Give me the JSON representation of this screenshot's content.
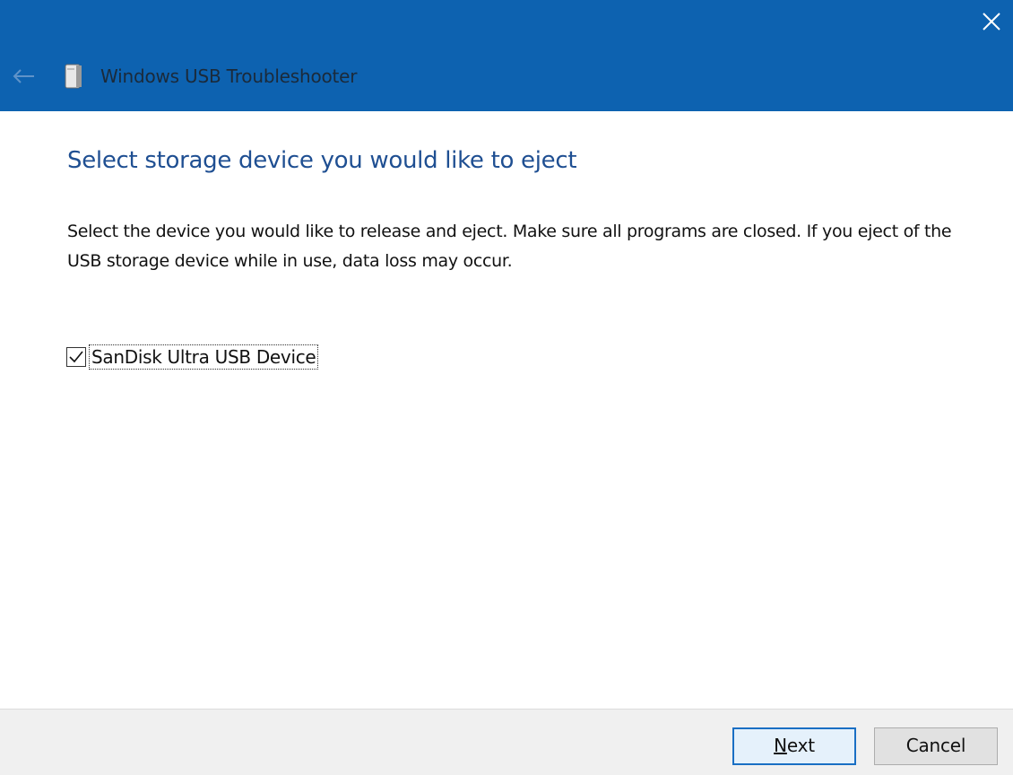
{
  "window": {
    "title": "Windows USB Troubleshooter",
    "accent_color": "#0d62b0",
    "back_icon": "back-arrow-icon",
    "close_icon": "close-icon",
    "app_icon": "usb-drive-icon"
  },
  "main": {
    "heading": "Select storage device you would like to eject",
    "description": "Select the device you would like to release and eject. Make sure all programs are closed. If you eject of the USB storage device while in use, data loss may occur.",
    "devices": [
      {
        "label": "SanDisk Ultra USB Device",
        "checked": true
      }
    ]
  },
  "footer": {
    "next_label_rest": "ext",
    "next_label_mnemonic": "N",
    "cancel_label": "Cancel"
  }
}
